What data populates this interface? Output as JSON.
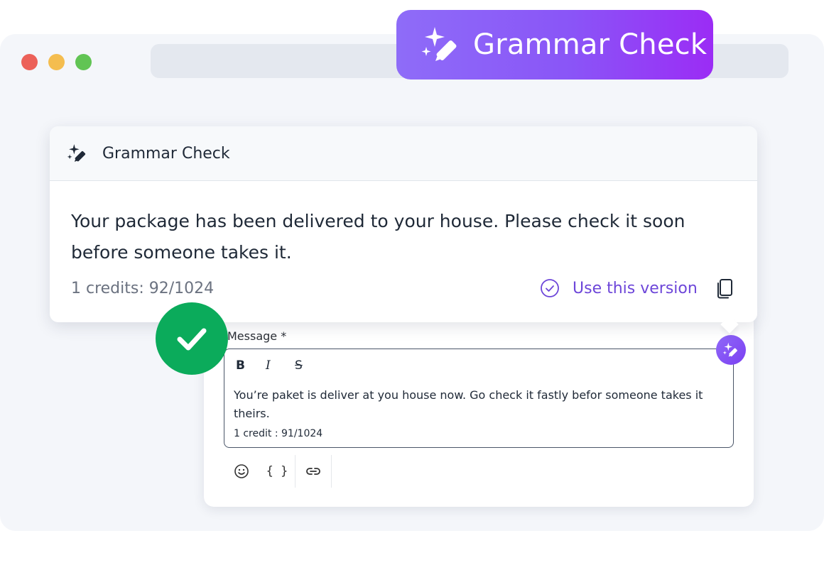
{
  "hero_badge": {
    "title": "Grammar Check",
    "icon": "sparkle-pen-icon"
  },
  "result_card": {
    "title": "Grammar Check",
    "icon": "sparkle-pen-icon",
    "corrected_text": "Your package has been delivered to your house. Please check it soon before someone takes it.",
    "credits": "1 credits: 92/1024",
    "use_version_label": "Use this version",
    "use_version_icon": "check-circle-icon",
    "copy_icon": "copy-icon"
  },
  "composer": {
    "label": "Message *",
    "format_buttons": {
      "bold": "B",
      "italic": "I",
      "strike": "S"
    },
    "original_text": "You’re paket is deliver at you house now. Go check it fastly befor someone takes it theirs.",
    "credit": "1 credit : 91/1024",
    "toolbar": {
      "emoji_icon": "smiley-icon",
      "braces": "{ }",
      "link_icon": "link-icon"
    }
  },
  "colors": {
    "accent": "#7b4ff2",
    "success": "#0bab5b",
    "link": "#6d46d9"
  }
}
